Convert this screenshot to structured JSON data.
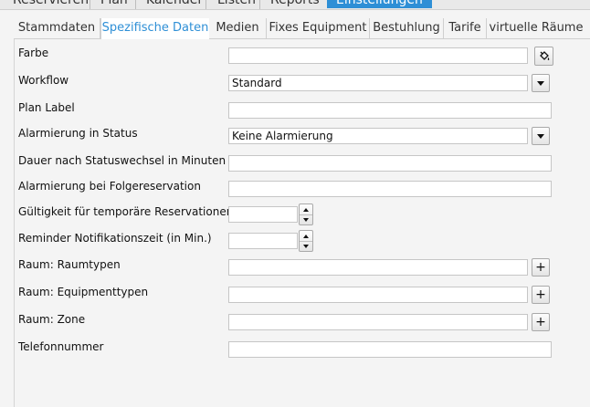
{
  "menu": {
    "items": [
      {
        "label": "Reservieren"
      },
      {
        "label": "Plan"
      },
      {
        "label": "Kalender"
      },
      {
        "label": "Listen"
      },
      {
        "label": "Reports"
      },
      {
        "label": "Einstellungen",
        "active": true
      }
    ]
  },
  "tabs": [
    {
      "label": "Stammdaten"
    },
    {
      "label": "Spezifische Daten",
      "active": true
    },
    {
      "label": "Medien"
    },
    {
      "label": "Fixes Equipment"
    },
    {
      "label": "Bestuhlung"
    },
    {
      "label": "Tarife"
    },
    {
      "label": "virtuelle Räume"
    }
  ],
  "form": {
    "farbe": {
      "label": "Farbe",
      "value": ""
    },
    "workflow": {
      "label": "Workflow",
      "value": "Standard"
    },
    "plan_label": {
      "label": "Plan Label",
      "value": ""
    },
    "alarmierung_status": {
      "label": "Alarmierung in Status",
      "value": "Keine Alarmierung"
    },
    "dauer": {
      "label": "Dauer nach Statuswechsel in Minuten",
      "value": ""
    },
    "folgereservation": {
      "label": "Alarmierung bei Folgereservation",
      "value": ""
    },
    "gueltigkeit": {
      "label": "Gültigkeit für temporäre Reservationen",
      "value": ""
    },
    "reminder": {
      "label": "Reminder Notifikationszeit (in Min.)",
      "value": ""
    },
    "raumtypen": {
      "label": "Raum: Raumtypen",
      "value": ""
    },
    "equipmenttypen": {
      "label": "Raum: Equipmenttypen",
      "value": ""
    },
    "zone": {
      "label": "Raum: Zone",
      "value": ""
    },
    "telefon": {
      "label": "Telefonnummer",
      "value": ""
    }
  },
  "buttons": {
    "plus": "+"
  },
  "colors": {
    "accent": "#2e8fd6",
    "tab_active_text": "#2e8fd6"
  }
}
